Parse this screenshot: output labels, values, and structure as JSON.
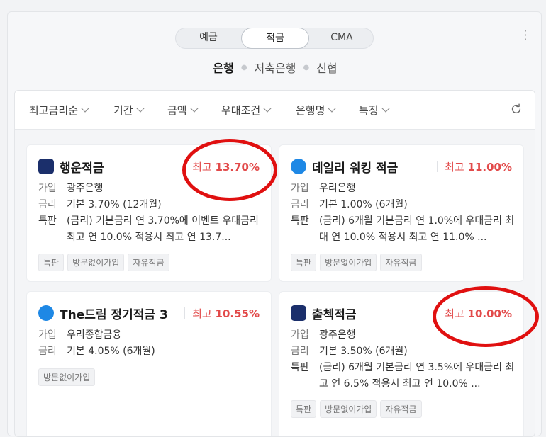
{
  "tabs": [
    "예금",
    "적금",
    "CMA"
  ],
  "selected_tab": "적금",
  "subtabs": [
    "은행",
    "저축은행",
    "신협"
  ],
  "selected_subtab": "은행",
  "filters": [
    "최고금리순",
    "기간",
    "금액",
    "우대조건",
    "은행명",
    "특징"
  ],
  "labels": {
    "join": "가입",
    "rate": "금리",
    "special": "특판"
  },
  "cards": [
    {
      "name": "행운적금",
      "bank_icon": "bank-logo-navy",
      "rate_prefix": "최고",
      "rate": "13.70%",
      "bank": "광주은행",
      "base_rate": "기본 3.70% (12개월)",
      "special": "(금리) 기본금리 연 3.70%에 이벤트 우대금리 최고 연 10.0% 적용시 최고 연 13.7...",
      "tags": [
        "특판",
        "방문없이가입",
        "자유적금"
      ]
    },
    {
      "name": "데일리 워킹 적금",
      "bank_icon": "bank-logo-sky",
      "rate_prefix": "최고",
      "rate": "11.00%",
      "bank": "우리은행",
      "base_rate": "기본 1.00% (6개월)",
      "special": "(금리) 6개월 기본금리 연 1.0%에 우대금리 최대 연 10.0% 적용시 최고 연 11.0% ...",
      "tags": [
        "특판",
        "방문없이가입",
        "자유적금"
      ]
    },
    {
      "name": "The드림 정기적금 3",
      "bank_icon": "bank-logo-sky",
      "rate_prefix": "최고",
      "rate": "10.55%",
      "bank": "우리종합금융",
      "base_rate": "기본 4.05% (6개월)",
      "tags": [
        "방문없이가입"
      ]
    },
    {
      "name": "출첵적금",
      "bank_icon": "bank-logo-navy",
      "rate_prefix": "최고",
      "rate": "10.00%",
      "bank": "광주은행",
      "base_rate": "기본 3.50% (6개월)",
      "special": "(금리) 6개월 기본금리 연 3.5%에 우대금리 최고 연 6.5% 적용시 최고 연 10.0% ...",
      "tags": [
        "특판",
        "방문없이가입",
        "자유적금"
      ]
    }
  ],
  "colors": {
    "rate": "#e24a4a",
    "annotation": "#e01010",
    "navy_bank": "#1b2f6b",
    "sky_bank": "#1e88e5"
  }
}
